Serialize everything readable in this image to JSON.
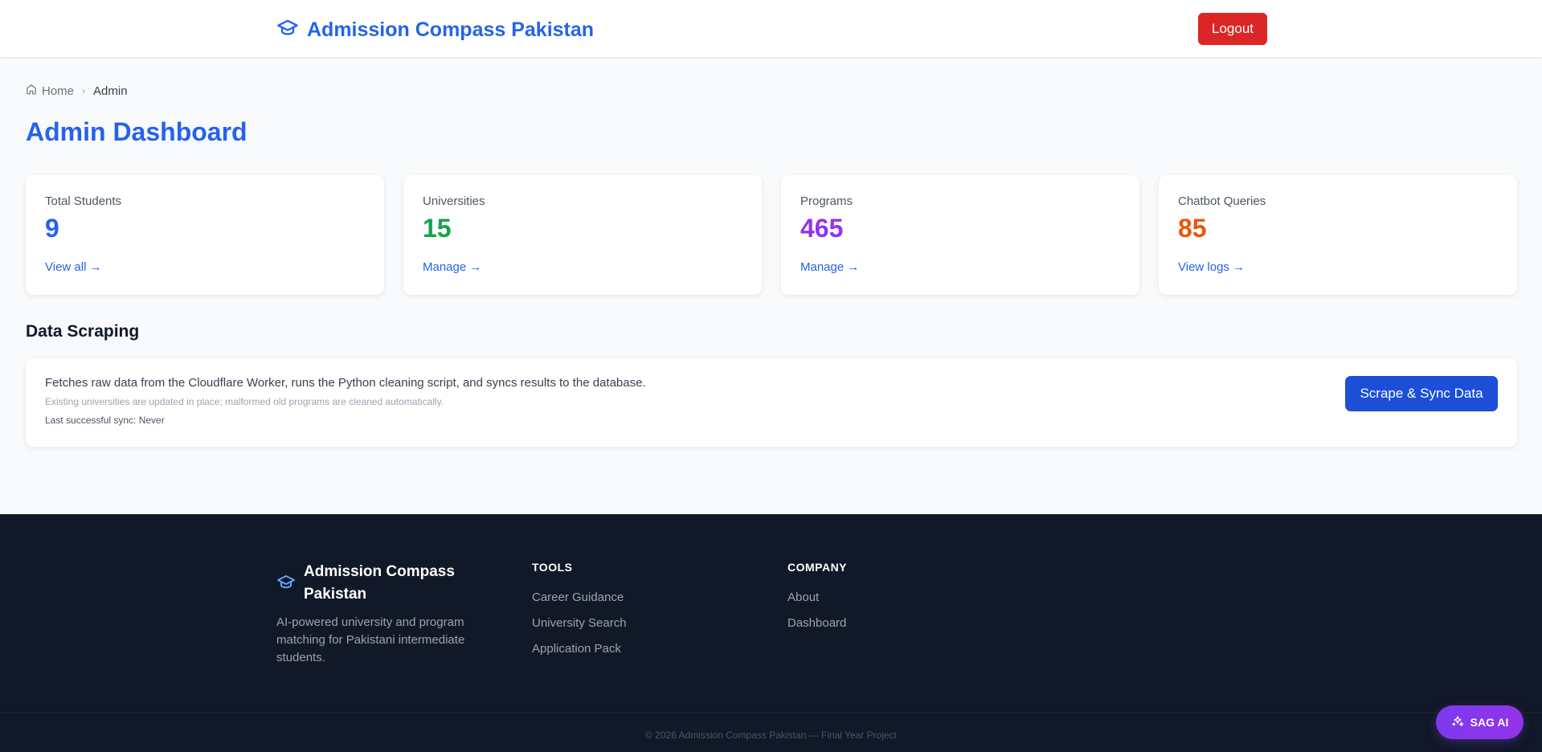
{
  "header": {
    "brand": "Admission Compass Pakistan",
    "logout_label": "Logout"
  },
  "breadcrumb": {
    "home": "Home",
    "current": "Admin"
  },
  "page_title": "Admin Dashboard",
  "stats": [
    {
      "label": "Total Students",
      "value": "9",
      "link": "View all →",
      "color": "#2563eb"
    },
    {
      "label": "Universities",
      "value": "15",
      "link": "Manage →",
      "color": "#16a34a"
    },
    {
      "label": "Programs",
      "value": "465",
      "link": "Manage →",
      "color": "#9333ea"
    },
    {
      "label": "Chatbot Queries",
      "value": "85",
      "link": "View logs →",
      "color": "#ea580c"
    }
  ],
  "scraping": {
    "title": "Data Scraping",
    "description": "Fetches raw data from the Cloudflare Worker, runs the Python cleaning script, and syncs results to the database.",
    "note": "Existing universities are updated in place; malformed old programs are cleaned automatically.",
    "last_sync": "Last successful sync: Never",
    "button_label": "Scrape & Sync Data"
  },
  "footer": {
    "brand": "Admission Compass Pakistan",
    "tagline": "AI-powered university and program matching for Pakistani intermediate students.",
    "tools_heading": "TOOLS",
    "tools": [
      "Career Guidance",
      "University Search",
      "Application Pack"
    ],
    "company_heading": "COMPANY",
    "company": [
      "About",
      "Dashboard"
    ],
    "copyright": "© 2026 Admission Compass Pakistan — Final Year Project"
  },
  "assistant": {
    "label": "SAG AI"
  },
  "colors": {
    "primary": "#2563eb",
    "danger": "#dc2626",
    "footer_bg": "#111827",
    "assistant": "#7c3aed"
  }
}
